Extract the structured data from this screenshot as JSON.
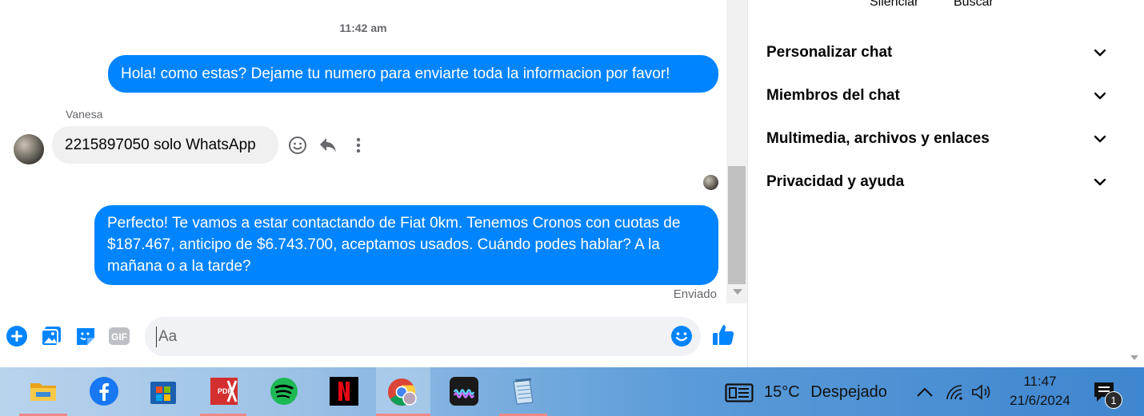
{
  "chat": {
    "timestamp": "11:42 am",
    "messages": [
      {
        "direction": "out",
        "text": "Hola! como estas? Dejame tu numero para enviarte toda la informacion por favor!"
      },
      {
        "direction": "in",
        "sender": "Vanesa",
        "text": "2215897050 solo WhatsApp"
      },
      {
        "direction": "out",
        "text": "Perfecto! Te vamos a estar contactando de Fiat 0km. Tenemos Cronos con cuotas de $187.467, anticipo de $6.743.700, aceptamos usados. Cuándo podes hablar? A la mañana o a la tarde?"
      }
    ],
    "status": "Enviado",
    "message_actions": [
      "react-icon",
      "reply-icon",
      "more-icon"
    ]
  },
  "composer": {
    "placeholder": "Aa",
    "left_icons": [
      "plus-icon",
      "photo-icon",
      "sticker-icon",
      "gif-icon"
    ],
    "gif_label": "GIF",
    "accent": "#0084ff"
  },
  "panel": {
    "top_actions": [
      "Silenciar",
      "Buscar"
    ],
    "sections": [
      {
        "label": "Personalizar chat"
      },
      {
        "label": "Miembros del chat"
      },
      {
        "label": "Multimedia, archivos y enlaces"
      },
      {
        "label": "Privacidad y ayuda"
      }
    ]
  },
  "taskbar": {
    "apps": [
      "file-explorer-icon",
      "facebook-icon",
      "store-icon",
      "pdf-icon",
      "spotify-icon",
      "netflix-icon",
      "chrome-icon",
      "deezer-icon",
      "notepad-icon"
    ],
    "weather": {
      "temp": "15°C",
      "condition": "Despejado"
    },
    "time": "11:47",
    "date": "21/6/2024",
    "notifications": "1"
  }
}
